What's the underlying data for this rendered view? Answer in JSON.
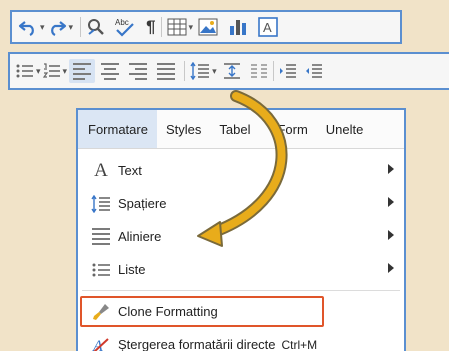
{
  "colors": {
    "background": "#f1e3c8",
    "frame_border": "#5b8fd0",
    "arrow": "#e8ac1b",
    "highlight_border": "#e0552a"
  },
  "toolbar_top": {
    "buttons": [
      {
        "icon": "undo-icon"
      },
      {
        "icon": "redo-icon"
      },
      {
        "icon": "find-replace-icon"
      },
      {
        "icon": "spelling-icon",
        "text": "Abc"
      },
      {
        "icon": "pilcrow-icon",
        "text": "¶"
      },
      {
        "icon": "table-icon"
      },
      {
        "icon": "image-icon"
      },
      {
        "icon": "chart-icon"
      },
      {
        "icon": "textbox-icon",
        "text": "A"
      }
    ]
  },
  "toolbar_bottom": {
    "buttons": [
      {
        "icon": "bullet-list-icon"
      },
      {
        "icon": "numbered-list-icon"
      },
      {
        "icon": "align-left-icon",
        "active": true
      },
      {
        "icon": "align-center-icon"
      },
      {
        "icon": "align-right-icon"
      },
      {
        "icon": "justify-icon"
      },
      {
        "icon": "line-spacing-icon"
      },
      {
        "icon": "paragraph-spacing-icon"
      },
      {
        "icon": "columns-icon"
      },
      {
        "icon": "increase-indent-icon"
      },
      {
        "icon": "decrease-indent-icon"
      }
    ]
  },
  "menu": {
    "menubar": [
      "Formatare",
      "Styles",
      "Tabel",
      "Form",
      "Unelte"
    ],
    "items": [
      {
        "label": "Text",
        "icon": "text-icon",
        "submenu": true
      },
      {
        "label": "Spațiere",
        "icon": "spacing-icon",
        "submenu": true
      },
      {
        "label": "Aliniere",
        "icon": "align-icon",
        "submenu": true
      },
      {
        "label": "Liste",
        "icon": "list-icon",
        "submenu": true
      }
    ],
    "clone": {
      "label": "Clone Formatting",
      "icon": "clone-brush-icon"
    },
    "clear": {
      "label": "Ștergerea formatării directe",
      "shortcut": "Ctrl+M",
      "icon": "clear-format-icon"
    }
  }
}
